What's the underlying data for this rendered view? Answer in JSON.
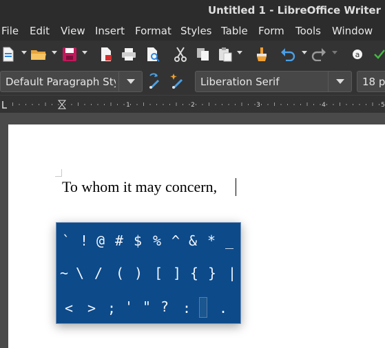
{
  "window": {
    "title": "Untitled 1 - LibreOffice Writer"
  },
  "menu": [
    "File",
    "Edit",
    "View",
    "Insert",
    "Format",
    "Styles",
    "Table",
    "Form",
    "Tools",
    "Window"
  ],
  "toolbar": {
    "icons": [
      "new-document-icon",
      "open-folder-icon",
      "save-icon",
      "export-pdf-icon",
      "print-icon",
      "print-preview-icon",
      "cut-icon",
      "copy-icon",
      "paste-icon",
      "clone-formatting-icon",
      "undo-icon",
      "redo-icon",
      "spelling-icon",
      "check-icon"
    ]
  },
  "formatting": {
    "paragraph_style": "Default Paragraph Sty",
    "font_name": "Liberation Serif",
    "font_size": "18 p"
  },
  "ruler": {
    "labels": [
      "1",
      "2",
      "3",
      "4",
      "5"
    ]
  },
  "document": {
    "text": "To whom it may concern,"
  },
  "keyboard": {
    "row1": [
      "`",
      "!",
      "@",
      "#",
      "$",
      "%",
      "^",
      "&",
      "*",
      "_"
    ],
    "row2": [
      "~",
      "\\",
      "/",
      "(",
      ")",
      "[",
      "]",
      "{",
      "}",
      "|"
    ],
    "row3": [
      "<",
      ">",
      ";",
      "'",
      "\"",
      "?",
      ":",
      "",
      "."
    ]
  },
  "colors": {
    "keyboard_bg": "#0c4a8a",
    "accent": "#2e86de",
    "chrome": "#333333"
  }
}
